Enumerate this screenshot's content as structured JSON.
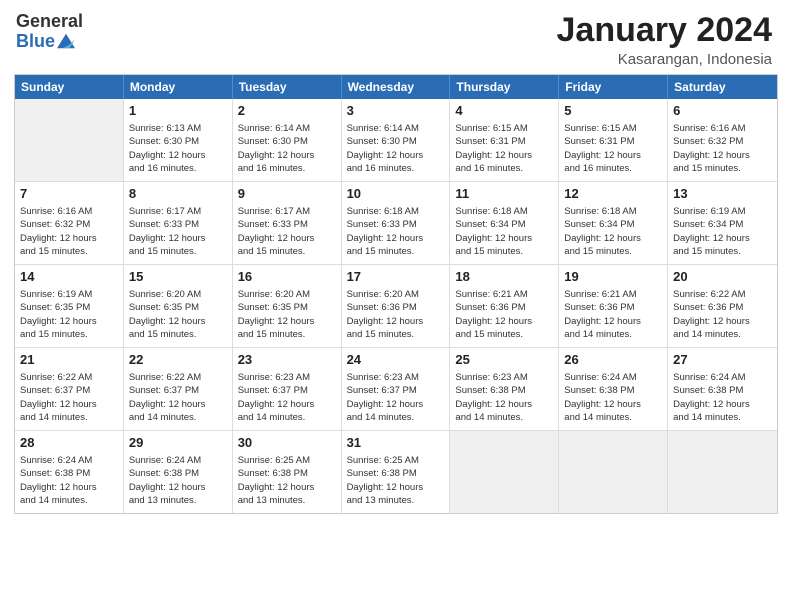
{
  "header": {
    "logo_general": "General",
    "logo_blue": "Blue",
    "month_title": "January 2024",
    "location": "Kasarangan, Indonesia"
  },
  "weekdays": [
    "Sunday",
    "Monday",
    "Tuesday",
    "Wednesday",
    "Thursday",
    "Friday",
    "Saturday"
  ],
  "weeks": [
    [
      {
        "day": "",
        "info": "",
        "shaded": true
      },
      {
        "day": "1",
        "info": "Sunrise: 6:13 AM\nSunset: 6:30 PM\nDaylight: 12 hours\nand 16 minutes."
      },
      {
        "day": "2",
        "info": "Sunrise: 6:14 AM\nSunset: 6:30 PM\nDaylight: 12 hours\nand 16 minutes."
      },
      {
        "day": "3",
        "info": "Sunrise: 6:14 AM\nSunset: 6:30 PM\nDaylight: 12 hours\nand 16 minutes."
      },
      {
        "day": "4",
        "info": "Sunrise: 6:15 AM\nSunset: 6:31 PM\nDaylight: 12 hours\nand 16 minutes."
      },
      {
        "day": "5",
        "info": "Sunrise: 6:15 AM\nSunset: 6:31 PM\nDaylight: 12 hours\nand 16 minutes."
      },
      {
        "day": "6",
        "info": "Sunrise: 6:16 AM\nSunset: 6:32 PM\nDaylight: 12 hours\nand 15 minutes."
      }
    ],
    [
      {
        "day": "7",
        "info": "Sunrise: 6:16 AM\nSunset: 6:32 PM\nDaylight: 12 hours\nand 15 minutes."
      },
      {
        "day": "8",
        "info": "Sunrise: 6:17 AM\nSunset: 6:33 PM\nDaylight: 12 hours\nand 15 minutes."
      },
      {
        "day": "9",
        "info": "Sunrise: 6:17 AM\nSunset: 6:33 PM\nDaylight: 12 hours\nand 15 minutes."
      },
      {
        "day": "10",
        "info": "Sunrise: 6:18 AM\nSunset: 6:33 PM\nDaylight: 12 hours\nand 15 minutes."
      },
      {
        "day": "11",
        "info": "Sunrise: 6:18 AM\nSunset: 6:34 PM\nDaylight: 12 hours\nand 15 minutes."
      },
      {
        "day": "12",
        "info": "Sunrise: 6:18 AM\nSunset: 6:34 PM\nDaylight: 12 hours\nand 15 minutes."
      },
      {
        "day": "13",
        "info": "Sunrise: 6:19 AM\nSunset: 6:34 PM\nDaylight: 12 hours\nand 15 minutes."
      }
    ],
    [
      {
        "day": "14",
        "info": "Sunrise: 6:19 AM\nSunset: 6:35 PM\nDaylight: 12 hours\nand 15 minutes."
      },
      {
        "day": "15",
        "info": "Sunrise: 6:20 AM\nSunset: 6:35 PM\nDaylight: 12 hours\nand 15 minutes."
      },
      {
        "day": "16",
        "info": "Sunrise: 6:20 AM\nSunset: 6:35 PM\nDaylight: 12 hours\nand 15 minutes."
      },
      {
        "day": "17",
        "info": "Sunrise: 6:20 AM\nSunset: 6:36 PM\nDaylight: 12 hours\nand 15 minutes."
      },
      {
        "day": "18",
        "info": "Sunrise: 6:21 AM\nSunset: 6:36 PM\nDaylight: 12 hours\nand 15 minutes."
      },
      {
        "day": "19",
        "info": "Sunrise: 6:21 AM\nSunset: 6:36 PM\nDaylight: 12 hours\nand 14 minutes."
      },
      {
        "day": "20",
        "info": "Sunrise: 6:22 AM\nSunset: 6:36 PM\nDaylight: 12 hours\nand 14 minutes."
      }
    ],
    [
      {
        "day": "21",
        "info": "Sunrise: 6:22 AM\nSunset: 6:37 PM\nDaylight: 12 hours\nand 14 minutes."
      },
      {
        "day": "22",
        "info": "Sunrise: 6:22 AM\nSunset: 6:37 PM\nDaylight: 12 hours\nand 14 minutes."
      },
      {
        "day": "23",
        "info": "Sunrise: 6:23 AM\nSunset: 6:37 PM\nDaylight: 12 hours\nand 14 minutes."
      },
      {
        "day": "24",
        "info": "Sunrise: 6:23 AM\nSunset: 6:37 PM\nDaylight: 12 hours\nand 14 minutes."
      },
      {
        "day": "25",
        "info": "Sunrise: 6:23 AM\nSunset: 6:38 PM\nDaylight: 12 hours\nand 14 minutes."
      },
      {
        "day": "26",
        "info": "Sunrise: 6:24 AM\nSunset: 6:38 PM\nDaylight: 12 hours\nand 14 minutes."
      },
      {
        "day": "27",
        "info": "Sunrise: 6:24 AM\nSunset: 6:38 PM\nDaylight: 12 hours\nand 14 minutes."
      }
    ],
    [
      {
        "day": "28",
        "info": "Sunrise: 6:24 AM\nSunset: 6:38 PM\nDaylight: 12 hours\nand 14 minutes."
      },
      {
        "day": "29",
        "info": "Sunrise: 6:24 AM\nSunset: 6:38 PM\nDaylight: 12 hours\nand 13 minutes."
      },
      {
        "day": "30",
        "info": "Sunrise: 6:25 AM\nSunset: 6:38 PM\nDaylight: 12 hours\nand 13 minutes."
      },
      {
        "day": "31",
        "info": "Sunrise: 6:25 AM\nSunset: 6:38 PM\nDaylight: 12 hours\nand 13 minutes."
      },
      {
        "day": "",
        "info": "",
        "shaded": true
      },
      {
        "day": "",
        "info": "",
        "shaded": true
      },
      {
        "day": "",
        "info": "",
        "shaded": true
      }
    ]
  ]
}
